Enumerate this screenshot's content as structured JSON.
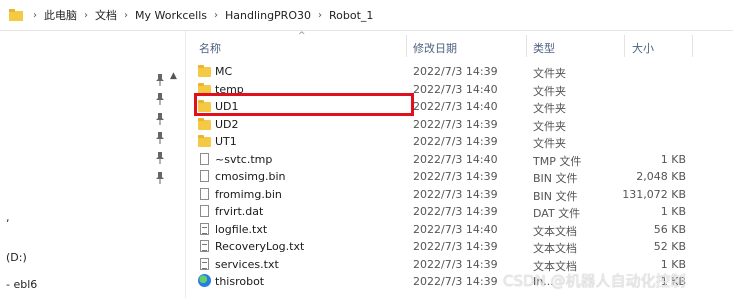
{
  "breadcrumb": [
    "此电脑",
    "文档",
    "My Workcells",
    "HandlingPRO30",
    "Robot_1"
  ],
  "left": {
    "comma": ",",
    "drive": "(D:)",
    "ebl": "- ebl6"
  },
  "columns": {
    "name": "名称",
    "date": "修改日期",
    "type": "类型",
    "size": "大小"
  },
  "files": [
    {
      "name": "MC",
      "date": "2022/7/3 14:39",
      "type": "文件夹",
      "size": "",
      "icon": "folder-icon"
    },
    {
      "name": "temp",
      "date": "2022/7/3 14:40",
      "type": "文件夹",
      "size": "",
      "icon": "folder-icon"
    },
    {
      "name": "UD1",
      "date": "2022/7/3 14:40",
      "type": "文件夹",
      "size": "",
      "icon": "folder-icon"
    },
    {
      "name": "UD2",
      "date": "2022/7/3 14:39",
      "type": "文件夹",
      "size": "",
      "icon": "folder-icon"
    },
    {
      "name": "UT1",
      "date": "2022/7/3 14:39",
      "type": "文件夹",
      "size": "",
      "icon": "folder-icon"
    },
    {
      "name": "~svtc.tmp",
      "date": "2022/7/3 14:40",
      "type": "TMP 文件",
      "size": "1 KB",
      "icon": "file-icon"
    },
    {
      "name": "cmosimg.bin",
      "date": "2022/7/3 14:39",
      "type": "BIN 文件",
      "size": "2,048 KB",
      "icon": "file-icon"
    },
    {
      "name": "fromimg.bin",
      "date": "2022/7/3 14:39",
      "type": "BIN 文件",
      "size": "131,072 KB",
      "icon": "file-icon"
    },
    {
      "name": "frvirt.dat",
      "date": "2022/7/3 14:39",
      "type": "DAT 文件",
      "size": "1 KB",
      "icon": "file-icon"
    },
    {
      "name": "logfile.txt",
      "date": "2022/7/3 14:40",
      "type": "文本文档",
      "size": "56 KB",
      "icon": "text-file-icon"
    },
    {
      "name": "RecoveryLog.txt",
      "date": "2022/7/3 14:39",
      "type": "文本文档",
      "size": "52 KB",
      "icon": "text-file-icon"
    },
    {
      "name": "services.txt",
      "date": "2022/7/3 14:39",
      "type": "文本文档",
      "size": "1 KB",
      "icon": "text-file-icon"
    },
    {
      "name": "thisrobot",
      "date": "2022/7/3 14:39",
      "type": "In...",
      "size": "1 KB",
      "icon": "app-icon"
    }
  ],
  "watermark": "CSDN @机器人自动化控制",
  "colors": {
    "highlight": "#e0111d",
    "folder": "#f6c945"
  }
}
